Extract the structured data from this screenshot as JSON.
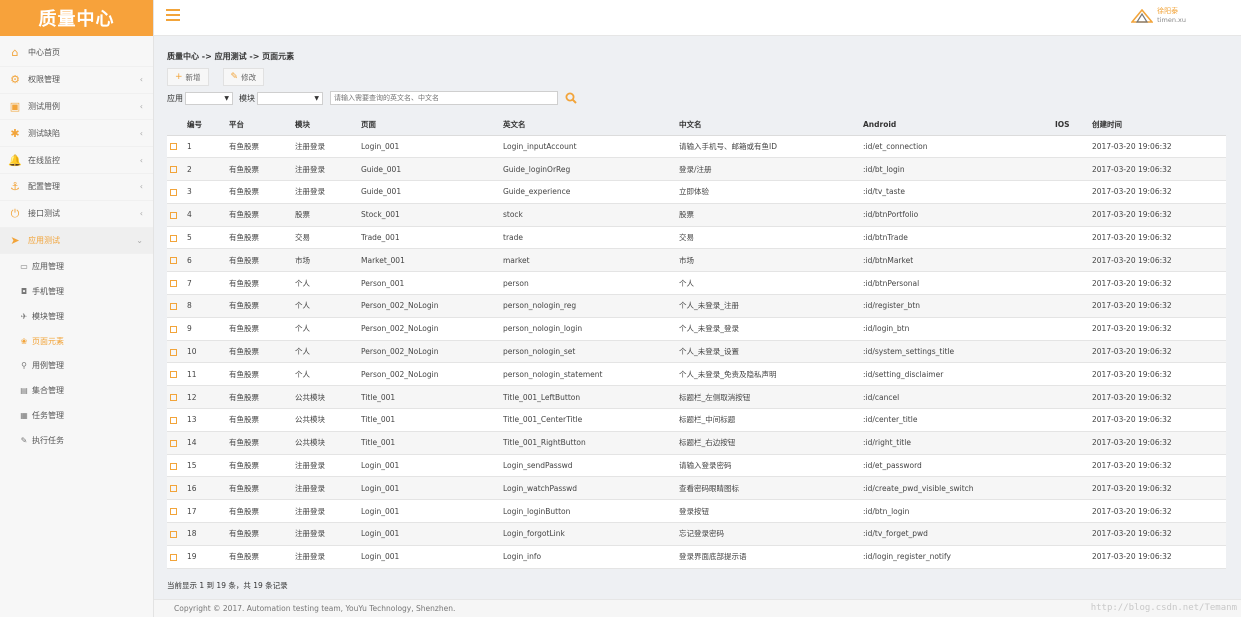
{
  "brand": {
    "title": "质量中心"
  },
  "header": {
    "user_name": "徐阳泰",
    "user_email": "timen.xu"
  },
  "sidebar": {
    "items": [
      {
        "name": "home",
        "label": "中心首页",
        "icon": "home-icon",
        "glyph": "⌂",
        "caret": false
      },
      {
        "name": "permission",
        "label": "权限管理",
        "icon": "gear-icon",
        "glyph": "⚙",
        "caret": true
      },
      {
        "name": "test-case",
        "label": "测试用例",
        "icon": "image-icon",
        "glyph": "▣",
        "caret": true
      },
      {
        "name": "test-defect",
        "label": "测试缺陷",
        "icon": "bug-icon",
        "glyph": "✱",
        "caret": true
      },
      {
        "name": "online-monitor",
        "label": "在线监控",
        "icon": "bell-icon",
        "glyph": "🔔",
        "caret": true
      },
      {
        "name": "config",
        "label": "配置管理",
        "icon": "anchor-icon",
        "glyph": "⚓",
        "caret": true
      },
      {
        "name": "api-test",
        "label": "接口测试",
        "icon": "power-icon",
        "glyph": "⏻",
        "caret": true
      },
      {
        "name": "app-test",
        "label": "应用测试",
        "icon": "paper-plane-icon",
        "glyph": "➤",
        "caret": true,
        "active": true
      }
    ],
    "subitems": [
      {
        "name": "app-manage",
        "label": "应用管理",
        "icon": "monitor-icon",
        "glyph": "▭"
      },
      {
        "name": "phone-manage",
        "label": "手机管理",
        "icon": "car-icon",
        "glyph": "◘"
      },
      {
        "name": "module-manage",
        "label": "模块管理",
        "icon": "plane-icon",
        "glyph": "✈"
      },
      {
        "name": "page-element",
        "label": "页面元素",
        "icon": "paw-icon",
        "glyph": "❀",
        "current": true
      },
      {
        "name": "usecase-manage",
        "label": "用例管理",
        "icon": "pin-icon",
        "glyph": "⚲"
      },
      {
        "name": "suite-manage",
        "label": "集合管理",
        "icon": "briefcase-icon",
        "glyph": "▤"
      },
      {
        "name": "task-manage",
        "label": "任务管理",
        "icon": "calendar-icon",
        "glyph": "▦"
      },
      {
        "name": "run-task",
        "label": "执行任务",
        "icon": "wrench-icon",
        "glyph": "✎"
      }
    ]
  },
  "breadcrumb": "质量中心 -> 应用测试 -> 页面元素",
  "toolbar": {
    "add_label": "新增",
    "edit_label": "修改"
  },
  "filter": {
    "app_label": "应用",
    "module_label": "模块",
    "search_placeholder": "请输入需要查询的英文名、中文名"
  },
  "table": {
    "columns": [
      "编号",
      "平台",
      "模块",
      "页面",
      "英文名",
      "中文名",
      "Android",
      "IOS",
      "创建时间"
    ],
    "rows": [
      [
        "1",
        "有鱼股票",
        "注册登录",
        "Login_001",
        "Login_inputAccount",
        "请输入手机号、邮箱或有鱼ID",
        ":id/et_connection",
        "",
        "2017-03-20 19:06:32"
      ],
      [
        "2",
        "有鱼股票",
        "注册登录",
        "Guide_001",
        "Guide_loginOrReg",
        "登录/注册",
        ":id/bt_login",
        "",
        "2017-03-20 19:06:32"
      ],
      [
        "3",
        "有鱼股票",
        "注册登录",
        "Guide_001",
        "Guide_experience",
        "立即体验",
        ":id/tv_taste",
        "",
        "2017-03-20 19:06:32"
      ],
      [
        "4",
        "有鱼股票",
        "股票",
        "Stock_001",
        "stock",
        "股票",
        ":id/btnPortfolio",
        "",
        "2017-03-20 19:06:32"
      ],
      [
        "5",
        "有鱼股票",
        "交易",
        "Trade_001",
        "trade",
        "交易",
        ":id/btnTrade",
        "",
        "2017-03-20 19:06:32"
      ],
      [
        "6",
        "有鱼股票",
        "市场",
        "Market_001",
        "market",
        "市场",
        ":id/btnMarket",
        "",
        "2017-03-20 19:06:32"
      ],
      [
        "7",
        "有鱼股票",
        "个人",
        "Person_001",
        "person",
        "个人",
        ":id/btnPersonal",
        "",
        "2017-03-20 19:06:32"
      ],
      [
        "8",
        "有鱼股票",
        "个人",
        "Person_002_NoLogin",
        "person_nologin_reg",
        "个人_未登录_注册",
        ":id/register_btn",
        "",
        "2017-03-20 19:06:32"
      ],
      [
        "9",
        "有鱼股票",
        "个人",
        "Person_002_NoLogin",
        "person_nologin_login",
        "个人_未登录_登录",
        ":id/login_btn",
        "",
        "2017-03-20 19:06:32"
      ],
      [
        "10",
        "有鱼股票",
        "个人",
        "Person_002_NoLogin",
        "person_nologin_set",
        "个人_未登录_设置",
        ":id/system_settings_title",
        "",
        "2017-03-20 19:06:32"
      ],
      [
        "11",
        "有鱼股票",
        "个人",
        "Person_002_NoLogin",
        "person_nologin_statement",
        "个人_未登录_免责及隐私声明",
        ":id/setting_disclaimer",
        "",
        "2017-03-20 19:06:32"
      ],
      [
        "12",
        "有鱼股票",
        "公共模块",
        "Title_001",
        "Title_001_LeftButton",
        "标题栏_左侧取消按钮",
        ":id/cancel",
        "",
        "2017-03-20 19:06:32"
      ],
      [
        "13",
        "有鱼股票",
        "公共模块",
        "Title_001",
        "Title_001_CenterTitle",
        "标题栏_中间标题",
        ":id/center_title",
        "",
        "2017-03-20 19:06:32"
      ],
      [
        "14",
        "有鱼股票",
        "公共模块",
        "Title_001",
        "Title_001_RightButton",
        "标题栏_右边按钮",
        ":id/right_title",
        "",
        "2017-03-20 19:06:32"
      ],
      [
        "15",
        "有鱼股票",
        "注册登录",
        "Login_001",
        "Login_sendPasswd",
        "请输入登录密码",
        ":id/et_password",
        "",
        "2017-03-20 19:06:32"
      ],
      [
        "16",
        "有鱼股票",
        "注册登录",
        "Login_001",
        "Login_watchPasswd",
        "查看密码眼睛图标",
        ":id/create_pwd_visible_switch",
        "",
        "2017-03-20 19:06:32"
      ],
      [
        "17",
        "有鱼股票",
        "注册登录",
        "Login_001",
        "Login_loginButton",
        "登录按钮",
        ":id/btn_login",
        "",
        "2017-03-20 19:06:32"
      ],
      [
        "18",
        "有鱼股票",
        "注册登录",
        "Login_001",
        "Login_forgotLink",
        "忘记登录密码",
        ":id/tv_forget_pwd",
        "",
        "2017-03-20 19:06:32"
      ],
      [
        "19",
        "有鱼股票",
        "注册登录",
        "Login_001",
        "Login_info",
        "登录界面底部提示语",
        ":id/login_register_notify",
        "",
        "2017-03-20 19:06:32"
      ]
    ]
  },
  "summary": "当前显示 1 到 19 条，共 19 条记录",
  "footer": {
    "copyright": "Copyright © 2017. Automation testing team, YouYu Technology, Shenzhen.",
    "watermark": "http://blog.csdn.net/Temanm"
  },
  "colors": {
    "accent": "#f7a23b",
    "sidebar_bg": "#f7f7f7",
    "page_bg": "#eef0f3"
  }
}
